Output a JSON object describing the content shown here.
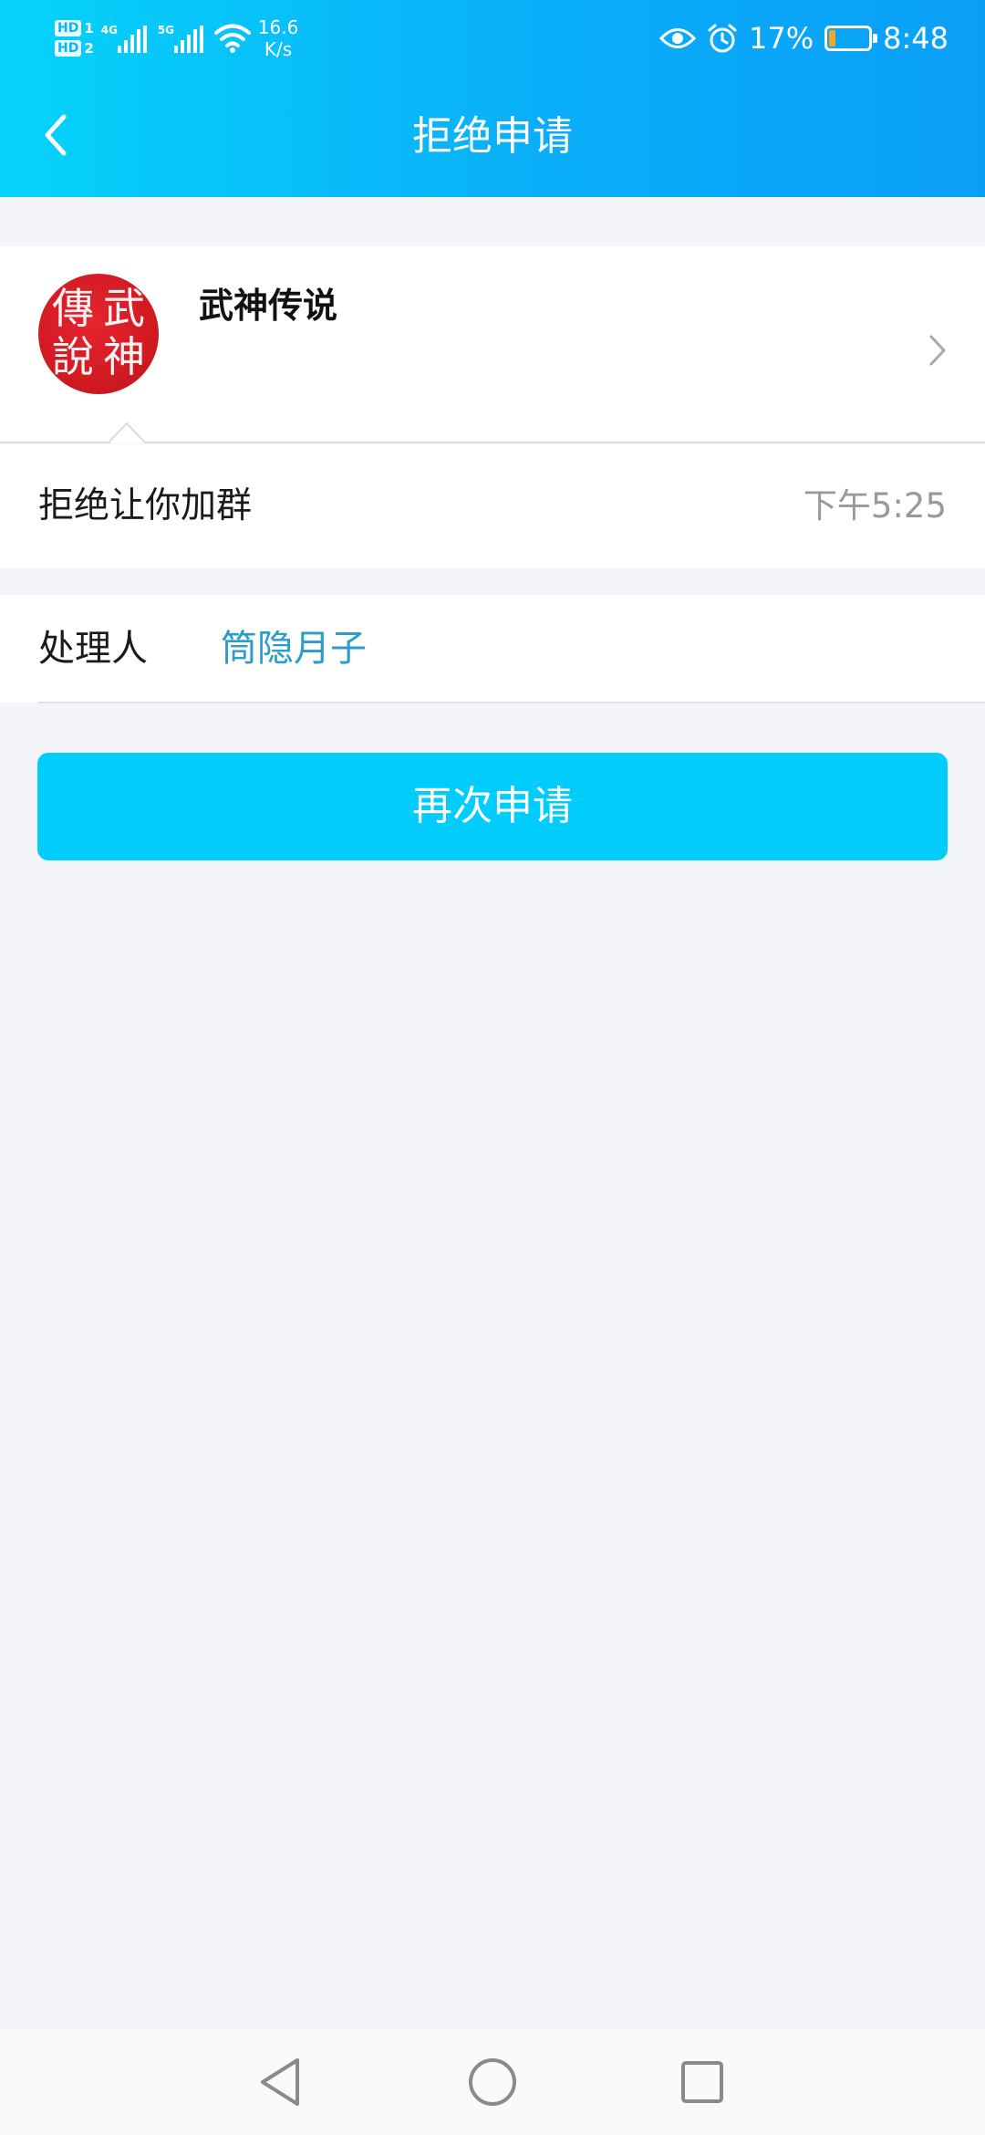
{
  "status_bar": {
    "sim1_badge": "HD",
    "sim1_number": "1",
    "sim2_badge": "HD",
    "sim2_number": "2",
    "network1": "4G",
    "network2": "5G",
    "speed_value": "16.6",
    "speed_unit": "K/s",
    "battery_percent": "17%",
    "battery_level": 0.17,
    "time": "8:48",
    "icons": [
      "signal-icon",
      "wifi-icon",
      "eye-icon",
      "alarm-icon",
      "battery-icon"
    ]
  },
  "header": {
    "title": "拒绝申请",
    "back_icon": "chevron-left-icon"
  },
  "group": {
    "name": "武神传说",
    "avatar_chars": [
      "傳",
      "武",
      "說",
      "神"
    ],
    "avatar_color": "#d21a22"
  },
  "message": {
    "text": "拒绝让你加群",
    "time": "下午5:25"
  },
  "handler": {
    "label": "处理人",
    "name": "筒隐月子",
    "name_color": "#2a9dc8"
  },
  "action": {
    "reapply_label": "再次申请",
    "button_color": "#00cdfc"
  },
  "nav": {
    "icons": [
      "back-triangle-icon",
      "home-circle-icon",
      "recents-square-icon"
    ]
  },
  "colors": {
    "header_gradient_start": "#05d3fb",
    "header_gradient_end": "#0a9ff7",
    "background": "#f4f5f9"
  }
}
